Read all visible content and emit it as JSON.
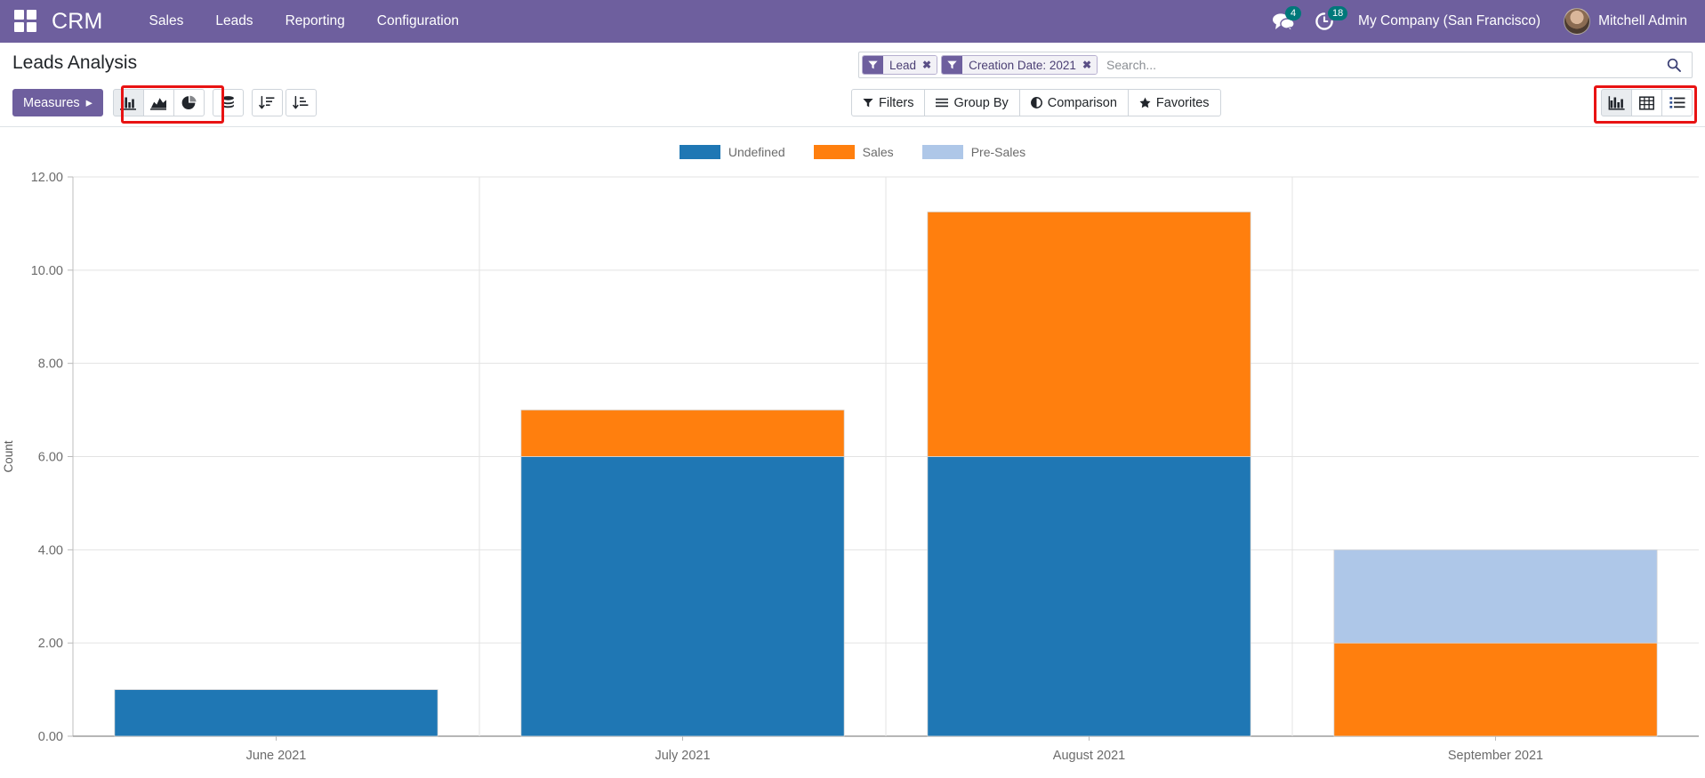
{
  "navbar": {
    "apps_icon": "apps-grid-icon",
    "brand": "CRM",
    "menus": [
      {
        "label": "Sales"
      },
      {
        "label": "Leads"
      },
      {
        "label": "Reporting"
      },
      {
        "label": "Configuration"
      }
    ],
    "messages_icon": "messages-icon",
    "messages_count": "4",
    "activities_icon": "clock-icon",
    "activities_count": "18",
    "company": "My Company (San Francisco)",
    "user": "Mitchell Admin",
    "avatar_name": "user-avatar"
  },
  "control_panel": {
    "title": "Leads Analysis",
    "search": {
      "placeholder": "Search...",
      "value": "",
      "search_icon": "search-icon",
      "facets": [
        {
          "icon": "filter-icon",
          "label": "Lead",
          "remove": "✖"
        },
        {
          "icon": "filter-icon",
          "label": "Creation Date: 2021",
          "remove": "✖"
        }
      ]
    },
    "measures_label": "Measures",
    "measures_caret": "▸",
    "chart_type_buttons": [
      {
        "name": "bar-chart-button",
        "icon": "bar-chart-icon",
        "active": true
      },
      {
        "name": "line-chart-button",
        "icon": "line-chart-icon",
        "active": false
      },
      {
        "name": "pie-chart-button",
        "icon": "pie-chart-icon",
        "active": false
      }
    ],
    "stacked_button": {
      "name": "stacked-button",
      "icon": "database-stack-icon"
    },
    "sort_buttons": [
      {
        "name": "sort-ascending-button",
        "icon": "sort-ascending-icon"
      },
      {
        "name": "sort-descending-button",
        "icon": "sort-descending-icon"
      }
    ],
    "filter_buttons": [
      {
        "label": "Filters",
        "icon": "funnel-icon"
      },
      {
        "label": "Group By",
        "icon": "hamburger-icon"
      },
      {
        "label": "Comparison",
        "icon": "half-circle-icon"
      },
      {
        "label": "Favorites",
        "icon": "star-icon"
      }
    ],
    "view_buttons": [
      {
        "name": "graph-view-button",
        "icon": "bar-chart-icon",
        "active": true
      },
      {
        "name": "pivot-view-button",
        "icon": "table-grid-icon",
        "active": false
      },
      {
        "name": "list-view-button",
        "icon": "list-icon",
        "active": false
      }
    ],
    "highlight_color": "#e81313"
  },
  "chart_data": {
    "type": "bar",
    "stacked": true,
    "title": "",
    "xlabel": "",
    "ylabel": "Count",
    "ylim": [
      0,
      12
    ],
    "yticks": [
      "0.00",
      "2.00",
      "4.00",
      "6.00",
      "8.00",
      "10.00",
      "12.00"
    ],
    "ytick_values": [
      0,
      2,
      4,
      6,
      8,
      10,
      12
    ],
    "grid": true,
    "legend_position": "top-center",
    "categories": [
      "June 2021",
      "July 2021",
      "August 2021",
      "September 2021"
    ],
    "series": [
      {
        "name": "Undefined",
        "color": "#1f77b4",
        "values": [
          1,
          6,
          6,
          0
        ]
      },
      {
        "name": "Sales",
        "color": "#ff7f0e",
        "values": [
          0,
          1,
          5.25,
          2
        ]
      },
      {
        "name": "Pre-Sales",
        "color": "#aec7e8",
        "values": [
          0,
          0,
          0,
          2
        ]
      }
    ],
    "totals": [
      1,
      7,
      11.25,
      4
    ]
  }
}
